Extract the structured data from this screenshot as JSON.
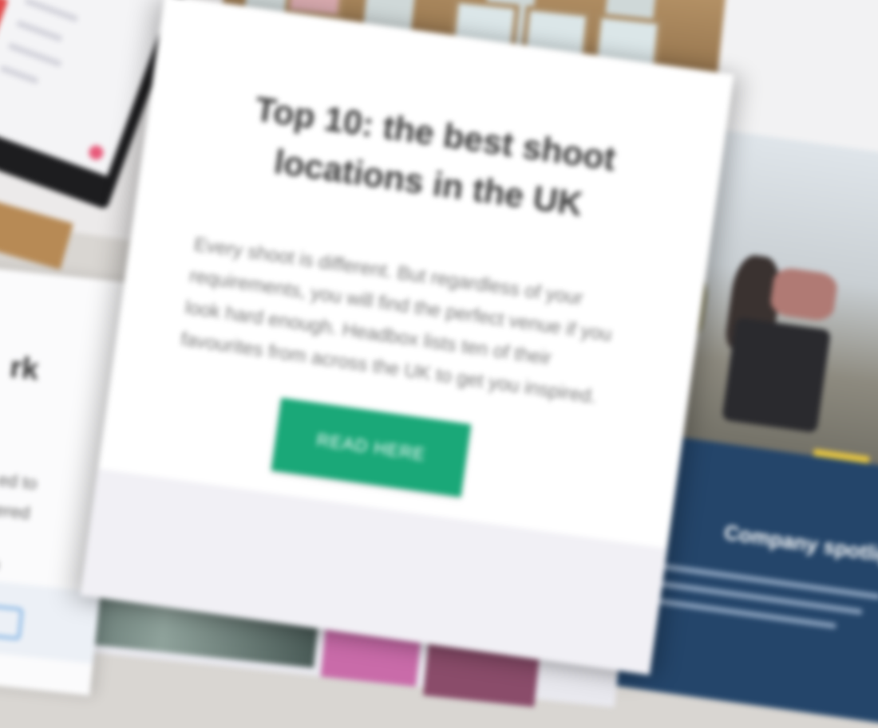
{
  "card": {
    "title": "Top 10: the best shoot locations in the UK",
    "body": "Every shoot is different. But regardless of your requirements, you will find the perfect venue if you look hard enough. Headbox lists ten of their favourites from across the UK to get you inspired.",
    "button_label": "READ HERE"
  },
  "left_panel": {
    "fragment_big": "rk",
    "fragment_lines": [
      "ed to",
      "ered",
      "o"
    ]
  },
  "right_panel": {
    "title": "Company spotlig"
  },
  "colors": {
    "button": "#1aa878",
    "blue_panel": "#24456a",
    "title_text": "#3a3a3a",
    "body_text": "#7a7a7a"
  },
  "icons": {
    "left_panel_icon": "pen-icon"
  }
}
